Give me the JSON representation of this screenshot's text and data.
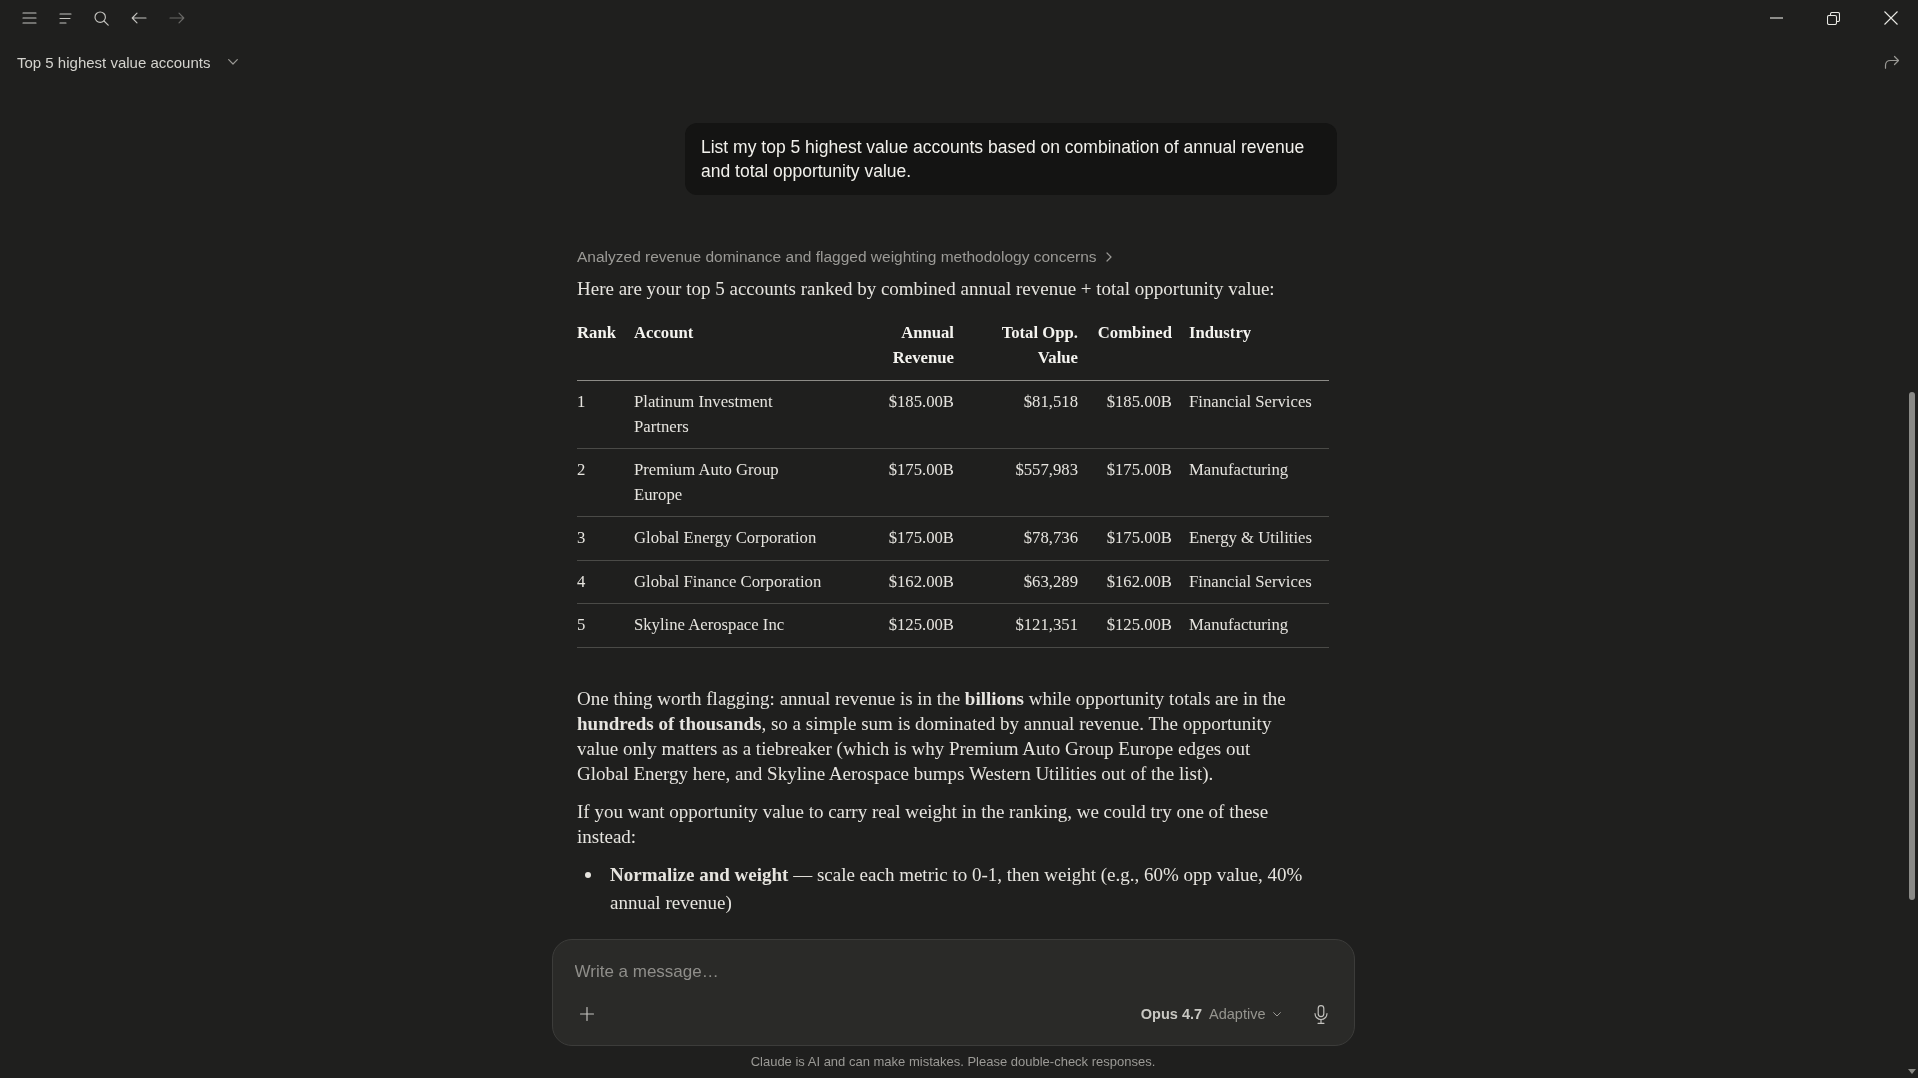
{
  "nav": {
    "back": {
      "disabled": false
    },
    "forward": {
      "disabled": true
    }
  },
  "conversation_title": "Top 5 highest value accounts",
  "user_message": "List my top 5 highest value accounts based on combination of annual revenue and total opportunity value.",
  "thinking_summary": "Analyzed revenue dominance and flagged weighting methodology concerns",
  "response": {
    "intro": "Here are your top 5 accounts ranked by combined annual revenue + total opportunity value:",
    "table": {
      "columns": [
        {
          "label": "Rank",
          "kind": "text"
        },
        {
          "label": "Account",
          "kind": "text"
        },
        {
          "label": "Annual Revenue",
          "kind": "number"
        },
        {
          "label": "Total Opp. Value",
          "kind": "number"
        },
        {
          "label": "Combined",
          "kind": "number"
        },
        {
          "label": "Industry",
          "kind": "text"
        }
      ],
      "rows": [
        [
          "1",
          "Platinum Investment Partners",
          "$185.00B",
          "$81,518",
          "$185.00B",
          "Financial Services"
        ],
        [
          "2",
          "Premium Auto Group Europe",
          "$175.00B",
          "$557,983",
          "$175.00B",
          "Manufacturing"
        ],
        [
          "3",
          "Global Energy Corporation",
          "$175.00B",
          "$78,736",
          "$175.00B",
          "Energy & Utilities"
        ],
        [
          "4",
          "Global Finance Corporation",
          "$162.00B",
          "$63,289",
          "$162.00B",
          "Financial Services"
        ],
        [
          "5",
          "Skyline Aerospace Inc",
          "$125.00B",
          "$121,351",
          "$125.00B",
          "Manufacturing"
        ]
      ]
    },
    "paragraphs": [
      "One thing worth flagging: annual revenue is in the **billions** while opportunity totals are in the **hundreds of thousands**, so a simple sum is dominated by annual revenue. The opportunity value only matters as a tiebreaker (which is why Premium Auto Group Europe edges out Global Energy here, and Skyline Aerospace bumps Western Utilities out of the list).",
      "If you want opportunity value to carry real weight in the ranking, we could try one of these instead:"
    ],
    "bullets": [
      "**Normalize and weight** — scale each metric to 0-1, then weight (e.g., 60% opp value, 40% annual revenue)"
    ]
  },
  "composer": {
    "placeholder": "Write a message…",
    "model": "Opus 4.7",
    "mode": "Adaptive"
  },
  "disclaimer": "Claude is AI and can make mistakes. Please double-check responses."
}
